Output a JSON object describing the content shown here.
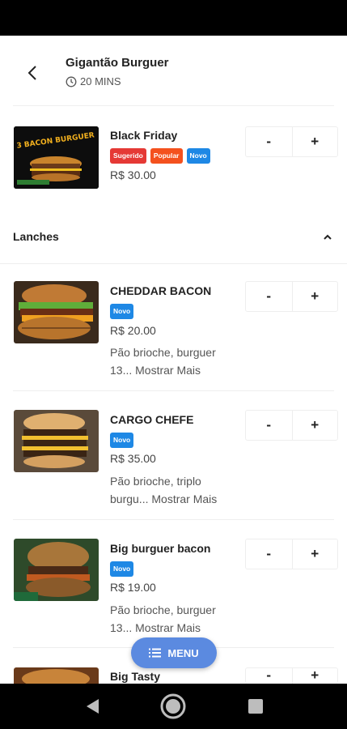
{
  "header": {
    "store_name": "Gigantão Burguer",
    "time_label": "20 MINS"
  },
  "featured": {
    "name": "Black Friday",
    "badges": [
      {
        "label": "Sugerido",
        "color": "#e53935"
      },
      {
        "label": "Popular",
        "color": "#f4511e"
      },
      {
        "label": "Novo",
        "color": "#1e88e5"
      }
    ],
    "price": "R$ 30.00",
    "minus": "-",
    "plus": "+"
  },
  "section": {
    "title": "Lanches"
  },
  "items": [
    {
      "name": "CHEDDAR BACON",
      "badge": "Novo",
      "price": "R$ 20.00",
      "desc_line1": "Pão brioche, burguer",
      "desc_line2": "13...",
      "more": "Mostrar Mais",
      "minus": "-",
      "plus": "+"
    },
    {
      "name": "CARGO CHEFE",
      "badge": "Novo",
      "price": "R$ 35.00",
      "desc_line1": "Pão brioche, triplo",
      "desc_line2": "burgu...",
      "more": "Mostrar Mais",
      "minus": "-",
      "plus": "+"
    },
    {
      "name": "Big burguer bacon",
      "badge": "Novo",
      "price": "R$ 19.00",
      "desc_line1": "Pão brioche, burguer",
      "desc_line2": "13...",
      "more": "Mostrar Mais",
      "minus": "-",
      "plus": "+"
    },
    {
      "name": "Big Tasty",
      "minus": "-",
      "plus": "+"
    }
  ],
  "menu_button": {
    "label": "MENU"
  },
  "colors": {
    "accent": "#5b8ae0",
    "badge_new": "#1e88e5"
  }
}
